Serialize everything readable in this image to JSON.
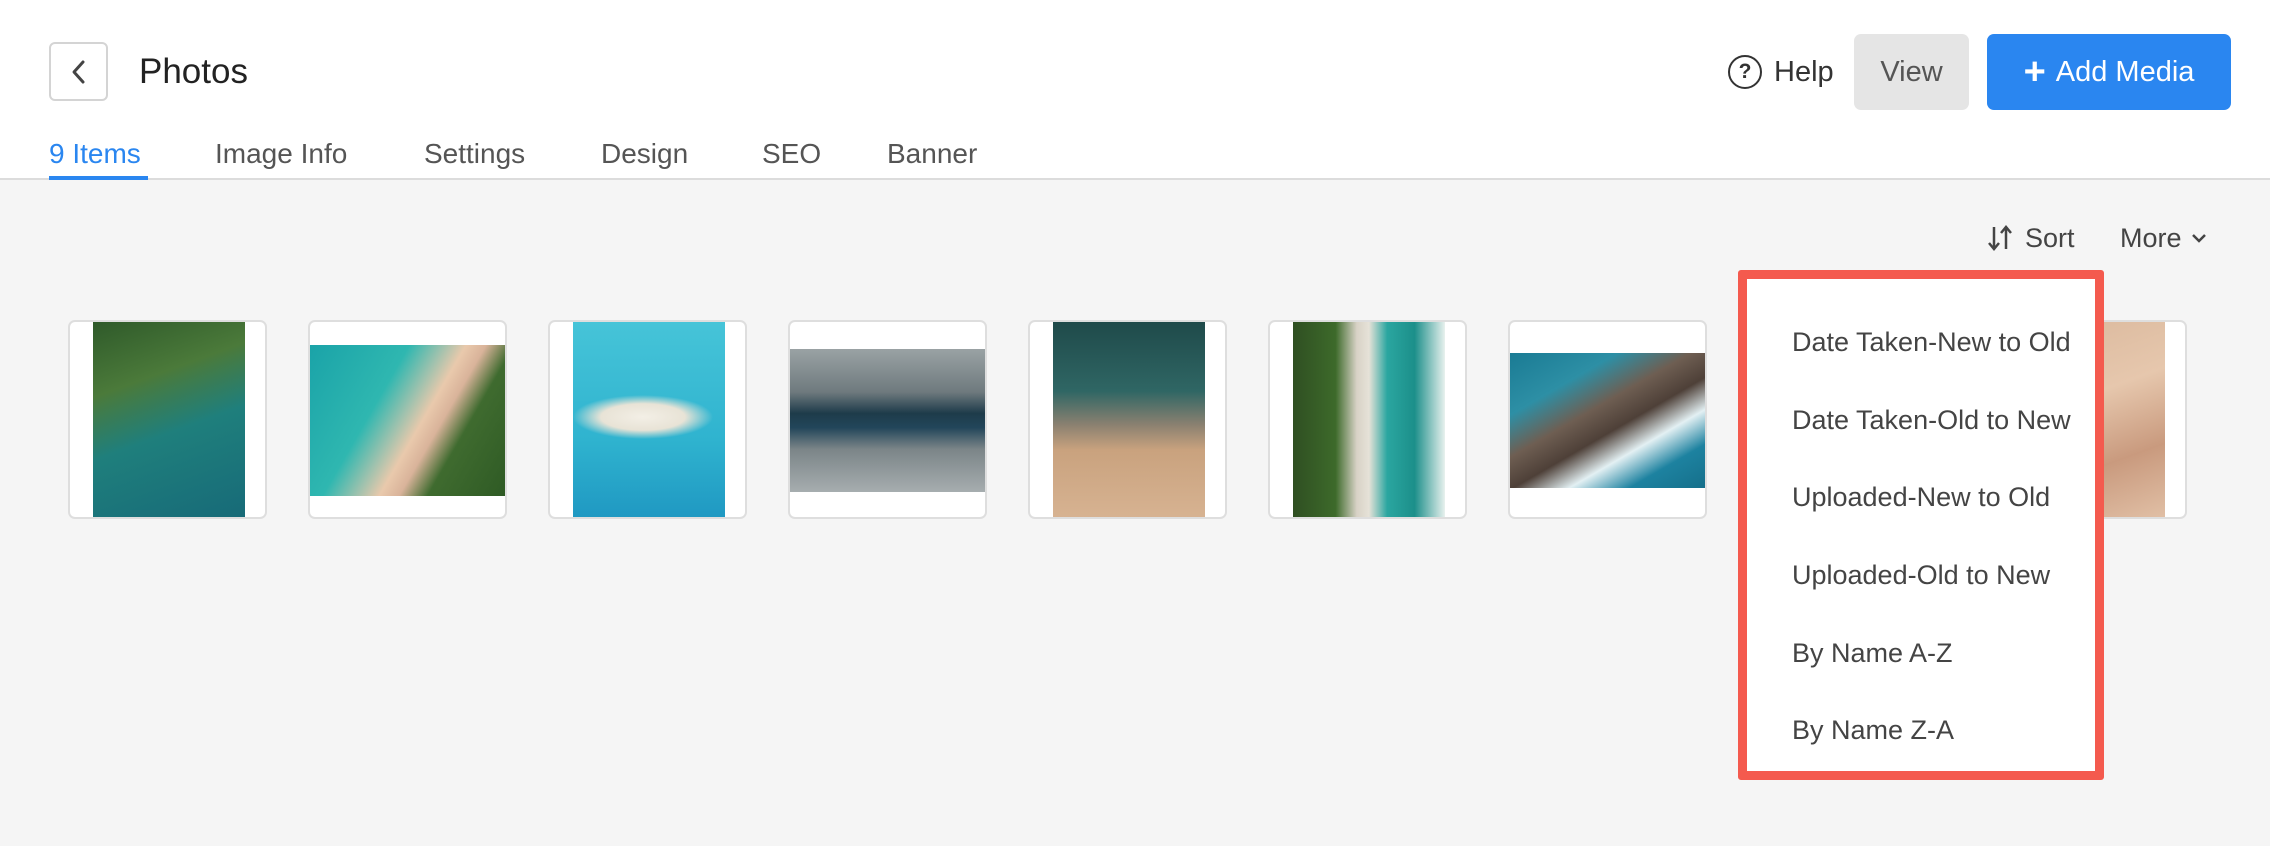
{
  "header": {
    "title": "Photos",
    "help_label": "Help",
    "view_label": "View",
    "add_media_label": "Add Media"
  },
  "tabs": [
    {
      "label": "9 Items",
      "active": true
    },
    {
      "label": "Image Info",
      "active": false
    },
    {
      "label": "Settings",
      "active": false
    },
    {
      "label": "Design",
      "active": false
    },
    {
      "label": "SEO",
      "active": false
    },
    {
      "label": "Banner",
      "active": false
    }
  ],
  "toolbar": {
    "sort_label": "Sort",
    "more_label": "More"
  },
  "sort_menu": {
    "items": [
      "Date Taken-New to Old",
      "Date Taken-Old to New",
      "Uploaded-New to Old",
      "Uploaded-Old to New",
      "By Name A-Z",
      "By Name Z-A"
    ]
  },
  "colors": {
    "accent": "#2a86f0",
    "highlight_border": "#f45a4e",
    "background": "#f5f5f5"
  },
  "icons": [
    "chevron-left-icon",
    "help-circle-icon",
    "plus-icon",
    "sort-arrows-icon",
    "chevron-down-icon"
  ]
}
